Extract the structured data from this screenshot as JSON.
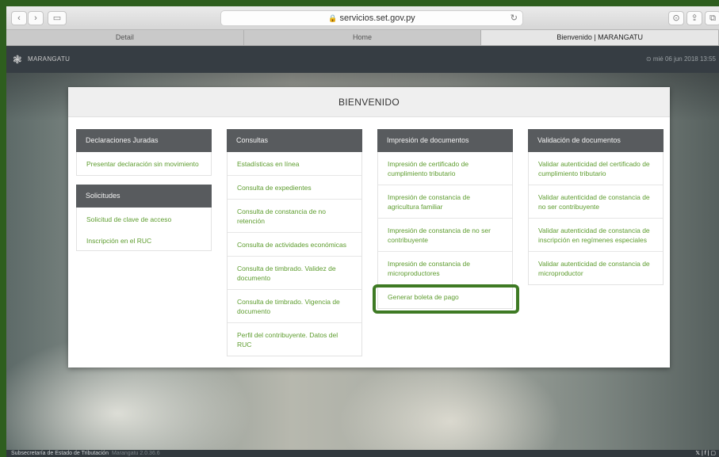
{
  "browser": {
    "url": "servicios.set.gov.py",
    "tabs": [
      {
        "label": "Detail"
      },
      {
        "label": "Home"
      },
      {
        "label": "Bienvenido | MARANGATU"
      }
    ]
  },
  "app": {
    "logo_text": "MARANGATU",
    "datetime": "mié 06 jun 2018 13:55"
  },
  "panel": {
    "title": "BIENVENIDO",
    "columns": [
      {
        "sections": [
          {
            "title": "Declaraciones Juradas",
            "items": [
              "Presentar declaración sin movimiento"
            ]
          },
          {
            "title": "Solicitudes",
            "items": [
              "Solicitud de clave de acceso",
              "Inscripción en el RUC"
            ]
          }
        ]
      },
      {
        "sections": [
          {
            "title": "Consultas",
            "items": [
              "Estadísticas en línea",
              "Consulta de expedientes",
              "Consulta de constancia de no retención",
              "Consulta de actividades económicas",
              "Consulta de timbrado. Validez de documento",
              "Consulta de timbrado. Vigencia de documento",
              "Perfil del contribuyente. Datos del RUC"
            ]
          }
        ]
      },
      {
        "sections": [
          {
            "title": "Impresión de documentos",
            "items": [
              "Impresión de certificado de cumplimiento tributario",
              "Impresión de constancia de agricultura familiar",
              "Impresión de constancia de no ser contribuyente",
              "Impresión de constancia de microproductores",
              "Generar boleta de pago"
            ]
          }
        ]
      },
      {
        "sections": [
          {
            "title": "Validación de documentos",
            "items": [
              "Validar autenticidad del certificado de cumplimiento tributario",
              "Validar autenticidad de constancia de no ser contribuyente",
              "Validar autenticidad de constancia de inscripción en regímenes especiales",
              "Validar autenticidad de constancia de microproductor"
            ]
          }
        ]
      }
    ]
  },
  "footer": {
    "org": "Subsecretaría de Estado de Tributación",
    "version": "Marangatu 2.0.36.6",
    "social": "𝕏 | f | ▢"
  },
  "colors": {
    "accent_link": "#5d9c2e",
    "highlight": "#3e7a24",
    "header_dark": "#363d43"
  }
}
